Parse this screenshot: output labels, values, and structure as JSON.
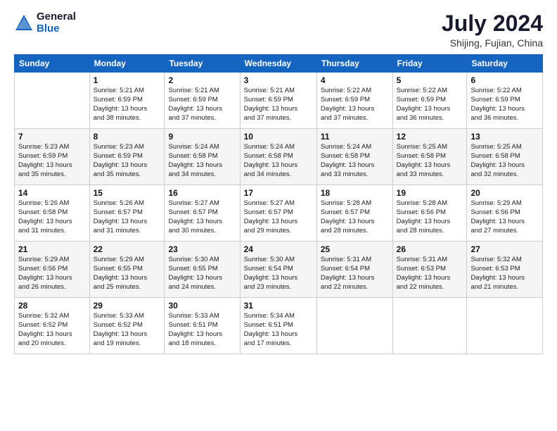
{
  "header": {
    "logo_general": "General",
    "logo_blue": "Blue",
    "main_title": "July 2024",
    "subtitle": "Shijing, Fujian, China"
  },
  "columns": [
    "Sunday",
    "Monday",
    "Tuesday",
    "Wednesday",
    "Thursday",
    "Friday",
    "Saturday"
  ],
  "weeks": [
    [
      {
        "day": "",
        "info": ""
      },
      {
        "day": "1",
        "info": "Sunrise: 5:21 AM\nSunset: 6:59 PM\nDaylight: 13 hours\nand 38 minutes."
      },
      {
        "day": "2",
        "info": "Sunrise: 5:21 AM\nSunset: 6:59 PM\nDaylight: 13 hours\nand 37 minutes."
      },
      {
        "day": "3",
        "info": "Sunrise: 5:21 AM\nSunset: 6:59 PM\nDaylight: 13 hours\nand 37 minutes."
      },
      {
        "day": "4",
        "info": "Sunrise: 5:22 AM\nSunset: 6:59 PM\nDaylight: 13 hours\nand 37 minutes."
      },
      {
        "day": "5",
        "info": "Sunrise: 5:22 AM\nSunset: 6:59 PM\nDaylight: 13 hours\nand 36 minutes."
      },
      {
        "day": "6",
        "info": "Sunrise: 5:22 AM\nSunset: 6:59 PM\nDaylight: 13 hours\nand 36 minutes."
      }
    ],
    [
      {
        "day": "7",
        "info": "Sunrise: 5:23 AM\nSunset: 6:59 PM\nDaylight: 13 hours\nand 35 minutes."
      },
      {
        "day": "8",
        "info": "Sunrise: 5:23 AM\nSunset: 6:59 PM\nDaylight: 13 hours\nand 35 minutes."
      },
      {
        "day": "9",
        "info": "Sunrise: 5:24 AM\nSunset: 6:58 PM\nDaylight: 13 hours\nand 34 minutes."
      },
      {
        "day": "10",
        "info": "Sunrise: 5:24 AM\nSunset: 6:58 PM\nDaylight: 13 hours\nand 34 minutes."
      },
      {
        "day": "11",
        "info": "Sunrise: 5:24 AM\nSunset: 6:58 PM\nDaylight: 13 hours\nand 33 minutes."
      },
      {
        "day": "12",
        "info": "Sunrise: 5:25 AM\nSunset: 6:58 PM\nDaylight: 13 hours\nand 33 minutes."
      },
      {
        "day": "13",
        "info": "Sunrise: 5:25 AM\nSunset: 6:58 PM\nDaylight: 13 hours\nand 32 minutes."
      }
    ],
    [
      {
        "day": "14",
        "info": "Sunrise: 5:26 AM\nSunset: 6:58 PM\nDaylight: 13 hours\nand 31 minutes."
      },
      {
        "day": "15",
        "info": "Sunrise: 5:26 AM\nSunset: 6:57 PM\nDaylight: 13 hours\nand 31 minutes."
      },
      {
        "day": "16",
        "info": "Sunrise: 5:27 AM\nSunset: 6:57 PM\nDaylight: 13 hours\nand 30 minutes."
      },
      {
        "day": "17",
        "info": "Sunrise: 5:27 AM\nSunset: 6:57 PM\nDaylight: 13 hours\nand 29 minutes."
      },
      {
        "day": "18",
        "info": "Sunrise: 5:28 AM\nSunset: 6:57 PM\nDaylight: 13 hours\nand 28 minutes."
      },
      {
        "day": "19",
        "info": "Sunrise: 5:28 AM\nSunset: 6:56 PM\nDaylight: 13 hours\nand 28 minutes."
      },
      {
        "day": "20",
        "info": "Sunrise: 5:29 AM\nSunset: 6:56 PM\nDaylight: 13 hours\nand 27 minutes."
      }
    ],
    [
      {
        "day": "21",
        "info": "Sunrise: 5:29 AM\nSunset: 6:56 PM\nDaylight: 13 hours\nand 26 minutes."
      },
      {
        "day": "22",
        "info": "Sunrise: 5:29 AM\nSunset: 6:55 PM\nDaylight: 13 hours\nand 25 minutes."
      },
      {
        "day": "23",
        "info": "Sunrise: 5:30 AM\nSunset: 6:55 PM\nDaylight: 13 hours\nand 24 minutes."
      },
      {
        "day": "24",
        "info": "Sunrise: 5:30 AM\nSunset: 6:54 PM\nDaylight: 13 hours\nand 23 minutes."
      },
      {
        "day": "25",
        "info": "Sunrise: 5:31 AM\nSunset: 6:54 PM\nDaylight: 13 hours\nand 22 minutes."
      },
      {
        "day": "26",
        "info": "Sunrise: 5:31 AM\nSunset: 6:53 PM\nDaylight: 13 hours\nand 22 minutes."
      },
      {
        "day": "27",
        "info": "Sunrise: 5:32 AM\nSunset: 6:53 PM\nDaylight: 13 hours\nand 21 minutes."
      }
    ],
    [
      {
        "day": "28",
        "info": "Sunrise: 5:32 AM\nSunset: 6:52 PM\nDaylight: 13 hours\nand 20 minutes."
      },
      {
        "day": "29",
        "info": "Sunrise: 5:33 AM\nSunset: 6:52 PM\nDaylight: 13 hours\nand 19 minutes."
      },
      {
        "day": "30",
        "info": "Sunrise: 5:33 AM\nSunset: 6:51 PM\nDaylight: 13 hours\nand 18 minutes."
      },
      {
        "day": "31",
        "info": "Sunrise: 5:34 AM\nSunset: 6:51 PM\nDaylight: 13 hours\nand 17 minutes."
      },
      {
        "day": "",
        "info": ""
      },
      {
        "day": "",
        "info": ""
      },
      {
        "day": "",
        "info": ""
      }
    ]
  ]
}
